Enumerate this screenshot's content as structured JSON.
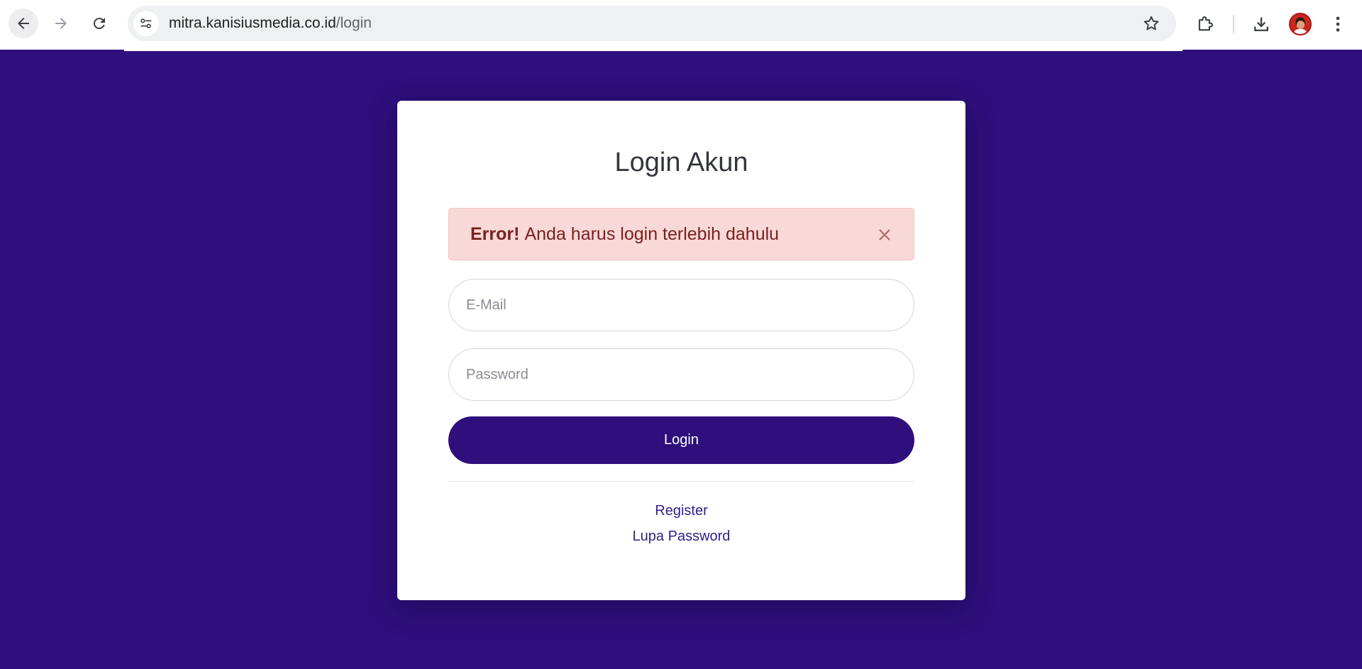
{
  "browser": {
    "url_host": "mitra.kanisiusmedia.co.id",
    "url_path": "/login",
    "icons": {
      "back": "back-arrow-icon",
      "forward": "forward-arrow-icon",
      "reload": "reload-icon",
      "site_info": "site-settings-icon",
      "bookmark": "star-icon",
      "extensions": "puzzle-icon",
      "downloads": "download-icon",
      "profile": "avatar",
      "menu": "kebab-menu-icon"
    }
  },
  "login": {
    "title": "Login Akun",
    "alert": {
      "strong": "Error!",
      "message": "Anda harus login terlebih dahulu"
    },
    "email_placeholder": "E-Mail",
    "password_placeholder": "Password",
    "submit_label": "Login",
    "register_label": "Register",
    "forgot_label": "Lupa Password"
  },
  "colors": {
    "background": "#2e0f7b",
    "card": "#ffffff",
    "alert_bg": "#f8d9d7",
    "alert_text": "#7a2020",
    "link": "#35208a"
  }
}
